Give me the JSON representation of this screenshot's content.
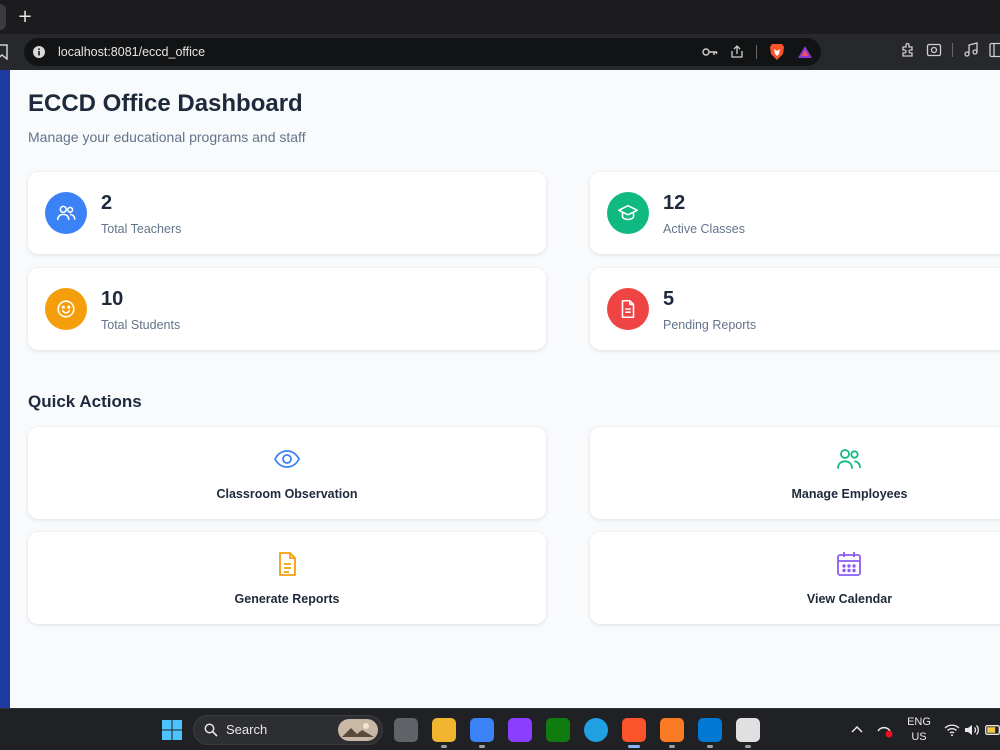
{
  "browser": {
    "new_tab_glyph": "+",
    "url": "localhost:8081/eccd_office",
    "icons": [
      "bookmark-icon",
      "site-info-icon",
      "key-icon",
      "share-icon",
      "brave-shields-icon",
      "brave-rewards-icon",
      "extensions-icon",
      "screenshot-icon",
      "media-icon",
      "sidebar-icon"
    ]
  },
  "page": {
    "title": "ECCD Office Dashboard",
    "subtitle": "Manage your educational programs and staff"
  },
  "stats": [
    {
      "value": "2",
      "label": "Total Teachers",
      "icon": "users-icon",
      "color": "#3b82f6"
    },
    {
      "value": "12",
      "label": "Active Classes",
      "icon": "graduation-cap-icon",
      "color": "#10b981"
    },
    {
      "value": "10",
      "label": "Total Students",
      "icon": "smile-icon",
      "color": "#f59e0b"
    },
    {
      "value": "5",
      "label": "Pending Reports",
      "icon": "document-icon",
      "color": "#ef4444"
    }
  ],
  "quick_actions": {
    "title": "Quick Actions",
    "items": [
      {
        "label": "Classroom Observation",
        "icon": "eye-icon",
        "color": "#3b82f6"
      },
      {
        "label": "Manage Employees",
        "icon": "users-icon",
        "color": "#10b981"
      },
      {
        "label": "Generate Reports",
        "icon": "document-icon",
        "color": "#f59e0b"
      },
      {
        "label": "View Calendar",
        "icon": "calendar-icon",
        "color": "#8b5cf6"
      }
    ]
  },
  "taskbar": {
    "search_label": "Search",
    "language": "ENG",
    "region": "US"
  }
}
